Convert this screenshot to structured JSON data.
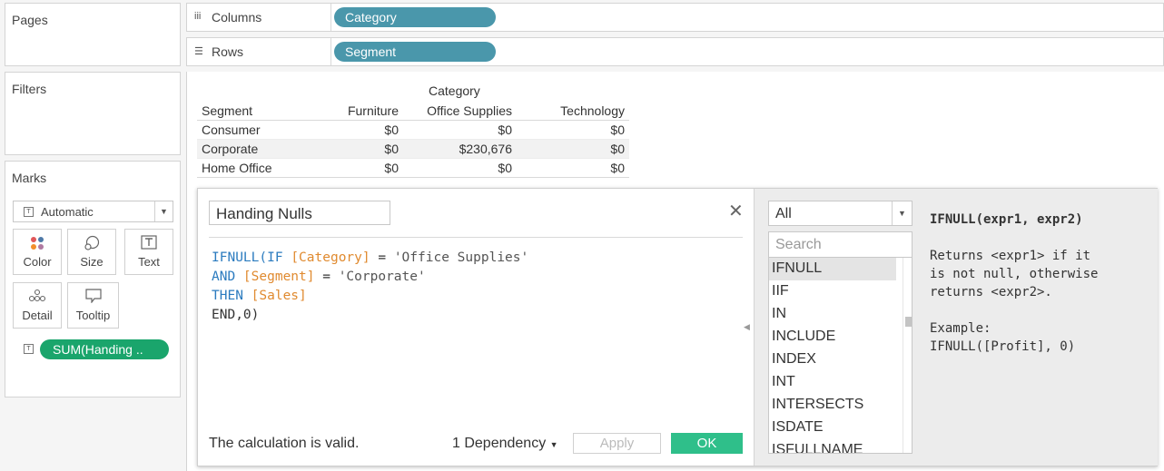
{
  "left_panels": {
    "pages": {
      "title": "Pages"
    },
    "filters": {
      "title": "Filters"
    },
    "marks": {
      "title": "Marks",
      "mark_type": "Automatic",
      "cards": {
        "color": "Color",
        "size": "Size",
        "text": "Text",
        "detail": "Detail",
        "tooltip": "Tooltip"
      },
      "field_pill": "SUM(Handing .."
    }
  },
  "shelves": {
    "columns": {
      "name": "Columns",
      "pill": "Category"
    },
    "rows": {
      "name": "Rows",
      "pill": "Segment"
    }
  },
  "crosstab": {
    "column_header": "Category",
    "row_header": "Segment",
    "columns": [
      "Furniture",
      "Office Supplies",
      "Technology"
    ],
    "rows": [
      {
        "segment": "Consumer",
        "values": [
          "$0",
          "$0",
          "$0"
        ]
      },
      {
        "segment": "Corporate",
        "values": [
          "$0",
          "$230,676",
          "$0"
        ]
      },
      {
        "segment": "Home Office",
        "values": [
          "$0",
          "$0",
          "$0"
        ]
      }
    ]
  },
  "calc_dialog": {
    "name": "Handing Nulls",
    "code": {
      "l1_a": "IFNULL(IF ",
      "l1_b": "[Category]",
      "l1_c": " = ",
      "l1_d": "'Office Supplies'",
      "l2_a": "AND ",
      "l2_b": "[Segment]",
      "l2_c": " = ",
      "l2_d": "'Corporate'",
      "l3_a": "THEN ",
      "l3_b": "[Sales]",
      "l4": "END,0)"
    },
    "status": "The calculation is valid.",
    "dependency": "1 Dependency",
    "apply_label": "Apply",
    "ok_label": "OK",
    "function_filter": "All",
    "search_placeholder": "Search",
    "functions": [
      "IFNULL",
      "IIF",
      "IN",
      "INCLUDE",
      "INDEX",
      "INT",
      "INTERSECTS",
      "ISDATE",
      "ISFULLNAME"
    ],
    "selected_function": "IFNULL",
    "doc": {
      "signature": "IFNULL(expr1, expr2)",
      "description": "Returns <expr1> if it\nis not null, otherwise\nreturns <expr2>.",
      "example_label": "Example:",
      "example": "IFNULL([Profit], 0)"
    }
  },
  "colors": {
    "blue_pill": "#4a97ab",
    "green_pill": "#1aa56c",
    "ok_button": "#2fbf8a",
    "keyword": "#2b7bbf",
    "field": "#e08a2f"
  }
}
